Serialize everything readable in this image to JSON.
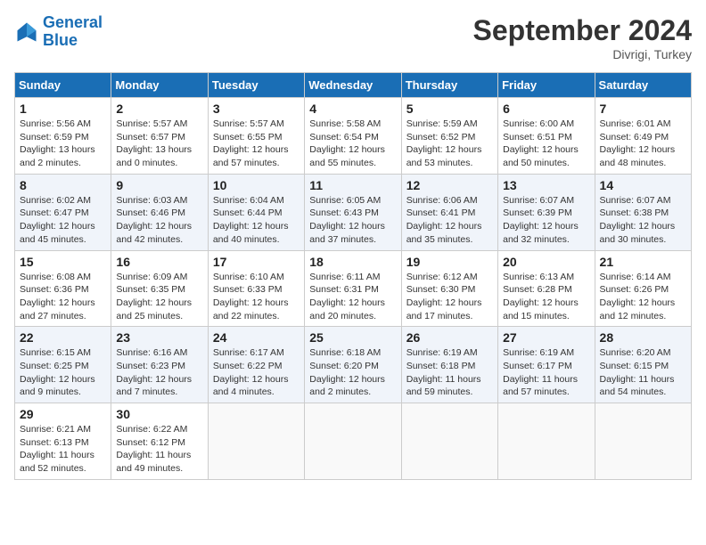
{
  "header": {
    "logo_general": "General",
    "logo_blue": "Blue",
    "month_title": "September 2024",
    "location": "Divrigi, Turkey"
  },
  "days_of_week": [
    "Sunday",
    "Monday",
    "Tuesday",
    "Wednesday",
    "Thursday",
    "Friday",
    "Saturday"
  ],
  "weeks": [
    [
      {
        "day": "1",
        "info": "Sunrise: 5:56 AM\nSunset: 6:59 PM\nDaylight: 13 hours and 2 minutes."
      },
      {
        "day": "2",
        "info": "Sunrise: 5:57 AM\nSunset: 6:57 PM\nDaylight: 13 hours and 0 minutes."
      },
      {
        "day": "3",
        "info": "Sunrise: 5:57 AM\nSunset: 6:55 PM\nDaylight: 12 hours and 57 minutes."
      },
      {
        "day": "4",
        "info": "Sunrise: 5:58 AM\nSunset: 6:54 PM\nDaylight: 12 hours and 55 minutes."
      },
      {
        "day": "5",
        "info": "Sunrise: 5:59 AM\nSunset: 6:52 PM\nDaylight: 12 hours and 53 minutes."
      },
      {
        "day": "6",
        "info": "Sunrise: 6:00 AM\nSunset: 6:51 PM\nDaylight: 12 hours and 50 minutes."
      },
      {
        "day": "7",
        "info": "Sunrise: 6:01 AM\nSunset: 6:49 PM\nDaylight: 12 hours and 48 minutes."
      }
    ],
    [
      {
        "day": "8",
        "info": "Sunrise: 6:02 AM\nSunset: 6:47 PM\nDaylight: 12 hours and 45 minutes."
      },
      {
        "day": "9",
        "info": "Sunrise: 6:03 AM\nSunset: 6:46 PM\nDaylight: 12 hours and 42 minutes."
      },
      {
        "day": "10",
        "info": "Sunrise: 6:04 AM\nSunset: 6:44 PM\nDaylight: 12 hours and 40 minutes."
      },
      {
        "day": "11",
        "info": "Sunrise: 6:05 AM\nSunset: 6:43 PM\nDaylight: 12 hours and 37 minutes."
      },
      {
        "day": "12",
        "info": "Sunrise: 6:06 AM\nSunset: 6:41 PM\nDaylight: 12 hours and 35 minutes."
      },
      {
        "day": "13",
        "info": "Sunrise: 6:07 AM\nSunset: 6:39 PM\nDaylight: 12 hours and 32 minutes."
      },
      {
        "day": "14",
        "info": "Sunrise: 6:07 AM\nSunset: 6:38 PM\nDaylight: 12 hours and 30 minutes."
      }
    ],
    [
      {
        "day": "15",
        "info": "Sunrise: 6:08 AM\nSunset: 6:36 PM\nDaylight: 12 hours and 27 minutes."
      },
      {
        "day": "16",
        "info": "Sunrise: 6:09 AM\nSunset: 6:35 PM\nDaylight: 12 hours and 25 minutes."
      },
      {
        "day": "17",
        "info": "Sunrise: 6:10 AM\nSunset: 6:33 PM\nDaylight: 12 hours and 22 minutes."
      },
      {
        "day": "18",
        "info": "Sunrise: 6:11 AM\nSunset: 6:31 PM\nDaylight: 12 hours and 20 minutes."
      },
      {
        "day": "19",
        "info": "Sunrise: 6:12 AM\nSunset: 6:30 PM\nDaylight: 12 hours and 17 minutes."
      },
      {
        "day": "20",
        "info": "Sunrise: 6:13 AM\nSunset: 6:28 PM\nDaylight: 12 hours and 15 minutes."
      },
      {
        "day": "21",
        "info": "Sunrise: 6:14 AM\nSunset: 6:26 PM\nDaylight: 12 hours and 12 minutes."
      }
    ],
    [
      {
        "day": "22",
        "info": "Sunrise: 6:15 AM\nSunset: 6:25 PM\nDaylight: 12 hours and 9 minutes."
      },
      {
        "day": "23",
        "info": "Sunrise: 6:16 AM\nSunset: 6:23 PM\nDaylight: 12 hours and 7 minutes."
      },
      {
        "day": "24",
        "info": "Sunrise: 6:17 AM\nSunset: 6:22 PM\nDaylight: 12 hours and 4 minutes."
      },
      {
        "day": "25",
        "info": "Sunrise: 6:18 AM\nSunset: 6:20 PM\nDaylight: 12 hours and 2 minutes."
      },
      {
        "day": "26",
        "info": "Sunrise: 6:19 AM\nSunset: 6:18 PM\nDaylight: 11 hours and 59 minutes."
      },
      {
        "day": "27",
        "info": "Sunrise: 6:19 AM\nSunset: 6:17 PM\nDaylight: 11 hours and 57 minutes."
      },
      {
        "day": "28",
        "info": "Sunrise: 6:20 AM\nSunset: 6:15 PM\nDaylight: 11 hours and 54 minutes."
      }
    ],
    [
      {
        "day": "29",
        "info": "Sunrise: 6:21 AM\nSunset: 6:13 PM\nDaylight: 11 hours and 52 minutes."
      },
      {
        "day": "30",
        "info": "Sunrise: 6:22 AM\nSunset: 6:12 PM\nDaylight: 11 hours and 49 minutes."
      },
      {
        "day": "",
        "info": ""
      },
      {
        "day": "",
        "info": ""
      },
      {
        "day": "",
        "info": ""
      },
      {
        "day": "",
        "info": ""
      },
      {
        "day": "",
        "info": ""
      }
    ]
  ]
}
